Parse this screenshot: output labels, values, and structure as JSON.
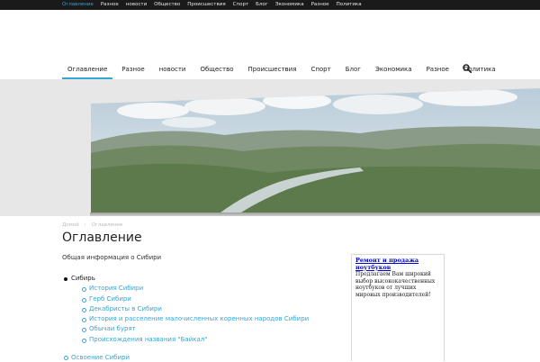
{
  "topbar": {
    "items": [
      {
        "label": "Оглавление",
        "active": true
      },
      {
        "label": "Разное"
      },
      {
        "label": "новости"
      },
      {
        "label": "Общество"
      },
      {
        "label": "Происшествия"
      },
      {
        "label": "Спорт"
      },
      {
        "label": "Блог"
      },
      {
        "label": "Экономика"
      },
      {
        "label": "Разное"
      },
      {
        "label": "Политика"
      }
    ]
  },
  "mainnav": {
    "items": [
      {
        "label": "Оглавление",
        "active": true
      },
      {
        "label": "Разное"
      },
      {
        "label": "новости"
      },
      {
        "label": "Общество"
      },
      {
        "label": "Происшествия"
      },
      {
        "label": "Спорт"
      },
      {
        "label": "Блог"
      },
      {
        "label": "Экономика"
      },
      {
        "label": "Разное"
      },
      {
        "label": "Политика"
      }
    ],
    "search_icon": "search-icon"
  },
  "breadcrumb": {
    "home": "Домой",
    "separator": "›",
    "current": "Оглавление"
  },
  "page": {
    "title": "Оглавление",
    "intro": "Общая информация о Сибири",
    "toc": {
      "root": "Сибирь",
      "children": [
        "История Сибири",
        "Герб Сибири",
        "Декабристы в Сибири",
        "История и расселение малочисленных коренных народов Сибири",
        "Обычаи бурят",
        "Происхождения названия \"Байкал\""
      ],
      "next": "Освоение Сибири"
    }
  },
  "ad": {
    "title": "Ремонт и продажа ноутбуков",
    "text": "Предлагаем Вам широкий выбор высококачественных ноутбуков от лучших мировых производителей!"
  },
  "colors": {
    "accent": "#35a5d6",
    "topbar": "#1a1a1a",
    "ad_link": "#0000cc"
  }
}
